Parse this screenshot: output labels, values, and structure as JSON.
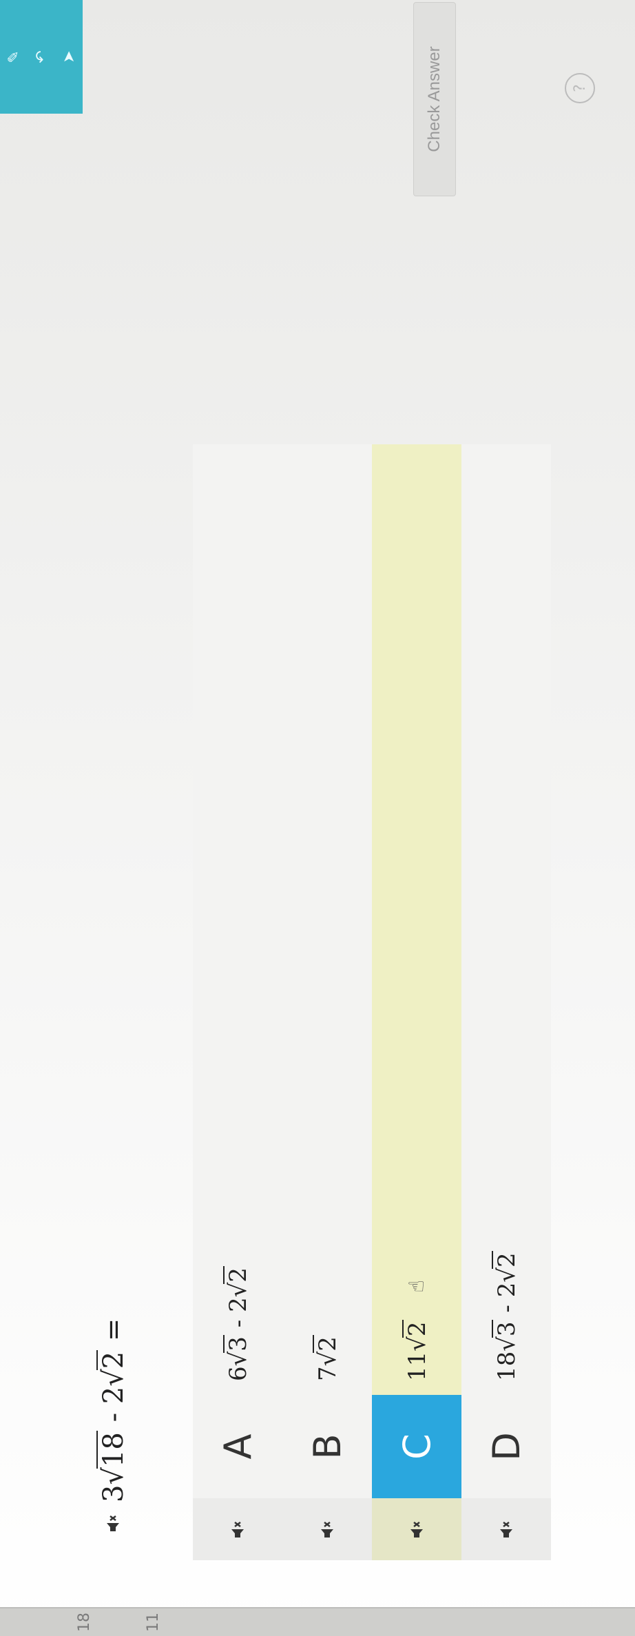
{
  "question": {
    "coef1": "3",
    "rad1": "18",
    "op": "-",
    "coef2": "2",
    "rad2": "2",
    "equals": "="
  },
  "choices": [
    {
      "letter": "A",
      "coef1": "6",
      "rad1": "3",
      "op": "-",
      "coef2": "2",
      "rad2": "2",
      "selected": false
    },
    {
      "letter": "B",
      "coef1": "7",
      "rad1": "2",
      "selected": false
    },
    {
      "letter": "C",
      "coef1": "11",
      "rad1": "2",
      "selected": true
    },
    {
      "letter": "D",
      "coef1": "18",
      "rad1": "3",
      "op": "-",
      "coef2": "2",
      "rad2": "2",
      "selected": false
    }
  ],
  "check_button": {
    "label": "Check Answer"
  },
  "edge_numbers": [
    "18",
    "11"
  ],
  "icons": {
    "speaker": "speaker-muted-icon",
    "cursor": "hand-pointer-icon"
  },
  "colors": {
    "selected_letter_bg": "#2aa7de",
    "selected_row_bg": "#eff0c4",
    "toolbar_bg": "#3bb5c8"
  }
}
